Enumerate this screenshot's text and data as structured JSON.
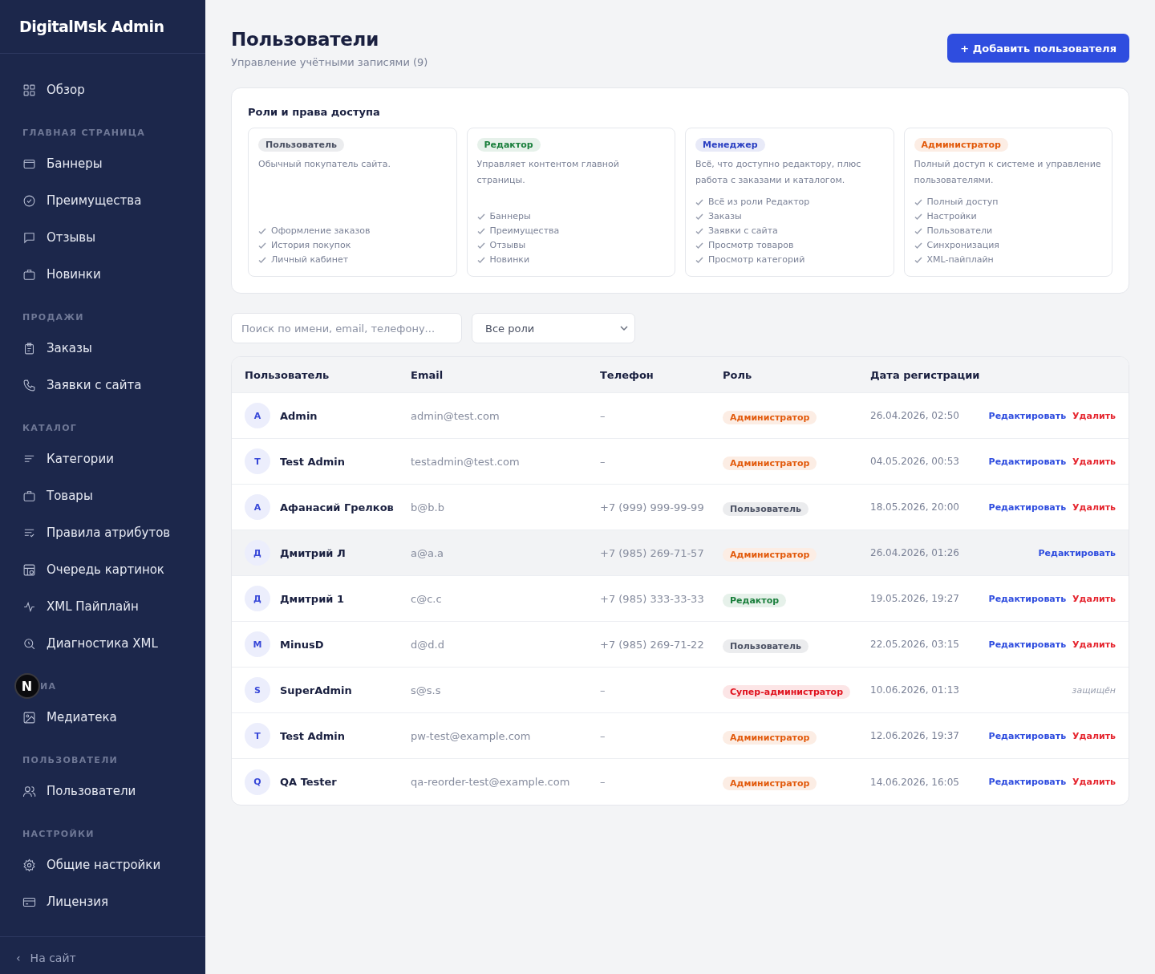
{
  "sidebar": {
    "logo": "DigitalMsk Admin",
    "sections": [
      {
        "items": [
          {
            "label": "Обзор"
          }
        ]
      },
      {
        "title": "ГЛАВНАЯ СТРАНИЦА",
        "items": [
          {
            "label": "Баннеры"
          },
          {
            "label": "Преимущества"
          },
          {
            "label": "Отзывы"
          },
          {
            "label": "Новинки"
          }
        ]
      },
      {
        "title": "ПРОДАЖИ",
        "items": [
          {
            "label": "Заказы"
          },
          {
            "label": "Заявки с сайта"
          }
        ]
      },
      {
        "title": "КАТАЛОГ",
        "items": [
          {
            "label": "Категории"
          },
          {
            "label": "Товары"
          },
          {
            "label": "Правила атрибутов"
          },
          {
            "label": "Очередь картинок"
          },
          {
            "label": "XML Пайплайн"
          },
          {
            "label": "Диагностика XML"
          }
        ]
      },
      {
        "title": "ИА",
        "badge": "N",
        "items": [
          {
            "label": "Медиатека"
          }
        ]
      },
      {
        "title": "ПОЛЬЗОВАТЕЛИ",
        "items": [
          {
            "label": "Пользователи"
          }
        ]
      },
      {
        "title": "НАСТРОЙКИ",
        "items": [
          {
            "label": "Общие настройки"
          },
          {
            "label": "Лицензия"
          }
        ]
      }
    ],
    "footer": {
      "icon": "‹",
      "label": "На сайт"
    }
  },
  "header": {
    "title": "Пользователи",
    "subtitle": "Управление учётными записями (9)",
    "add_button": "+ Добавить пользователя"
  },
  "roles": {
    "title": "Роли и права доступа",
    "cards": [
      {
        "color": "#4b5163",
        "badge": "Пользователь",
        "description": "Обычный покупатель сайта.",
        "permissions": [
          "Оформление заказов",
          "История покупок",
          "Личный кабинет"
        ]
      },
      {
        "color": "#1a7f3c",
        "badge": "Редактор",
        "description": "Управляет контентом главной страницы.",
        "permissions": [
          "Баннеры",
          "Преимущества",
          "Отзывы",
          "Новинки"
        ]
      },
      {
        "color": "#2a3fc2",
        "badge": "Менеджер",
        "description": "Всё, что доступно редактору, плюс работа с заказами и каталогом.",
        "permissions": [
          "Всё из роли Редактор",
          "Заказы",
          "Заявки с сайта",
          "Просмотр товаров",
          "Просмотр категорий"
        ]
      },
      {
        "color": "#e25a0c",
        "badge": "Администратор",
        "description": "Полный доступ к системе и управление пользователями.",
        "permissions": [
          "Полный доступ",
          "Настройки",
          "Пользователи",
          "Синхронизация",
          "XML-пайплайн"
        ]
      }
    ]
  },
  "filters": {
    "search": {
      "placeholder": "Поиск по имени, email, телефону..."
    },
    "role_select": {
      "value": "Все роли"
    }
  },
  "table": {
    "columns": [
      "Пользователь",
      "Email",
      "Телефон",
      "Роль",
      "Дата регистрации"
    ],
    "rows": [
      {
        "initial": "A",
        "name": "Admin",
        "email": "admin@test.com",
        "phone": "–",
        "role": {
          "label": "Администратор",
          "color": "#e25a0c"
        },
        "date": "26.04.2026, 02:50",
        "selected": false,
        "actions": [
          {
            "kind": "edit",
            "label": "Редактировать"
          },
          {
            "kind": "delete",
            "label": "Удалить"
          }
        ]
      },
      {
        "initial": "T",
        "name": "Test Admin",
        "email": "testadmin@test.com",
        "phone": "–",
        "role": {
          "label": "Администратор",
          "color": "#e25a0c"
        },
        "date": "04.05.2026, 00:53",
        "selected": false,
        "actions": [
          {
            "kind": "edit",
            "label": "Редактировать"
          },
          {
            "kind": "delete",
            "label": "Удалить"
          }
        ]
      },
      {
        "initial": "А",
        "name": "Афанасий Грелков",
        "email": "b@b.b",
        "phone": "+7 (999) 999-99-99",
        "role": {
          "label": "Пользователь",
          "color": "#4b5163"
        },
        "date": "18.05.2026, 20:00",
        "selected": false,
        "actions": [
          {
            "kind": "edit",
            "label": "Редактировать"
          },
          {
            "kind": "delete",
            "label": "Удалить"
          }
        ]
      },
      {
        "initial": "Д",
        "name": "Дмитрий Л",
        "email": "a@a.a",
        "phone": "+7 (985) 269-71-57",
        "role": {
          "label": "Администратор",
          "color": "#e25a0c"
        },
        "date": "26.04.2026, 01:26",
        "selected": true,
        "actions": [
          {
            "kind": "edit",
            "label": "Редактировать"
          }
        ]
      },
      {
        "initial": "Д",
        "name": "Дмитрий 1",
        "email": "c@c.c",
        "phone": "+7 (985) 333-33-33",
        "role": {
          "label": "Редактор",
          "color": "#1a7f3c"
        },
        "date": "19.05.2026, 19:27",
        "selected": false,
        "actions": [
          {
            "kind": "edit",
            "label": "Редактировать"
          },
          {
            "kind": "delete",
            "label": "Удалить"
          }
        ]
      },
      {
        "initial": "M",
        "name": "MinusD",
        "email": "d@d.d",
        "phone": "+7 (985) 269-71-22",
        "role": {
          "label": "Пользователь",
          "color": "#4b5163"
        },
        "date": "22.05.2026, 03:15",
        "selected": false,
        "actions": [
          {
            "kind": "edit",
            "label": "Редактировать"
          },
          {
            "kind": "delete",
            "label": "Удалить"
          }
        ]
      },
      {
        "initial": "S",
        "name": "SuperAdmin",
        "email": "s@s.s",
        "phone": "–",
        "role": {
          "label": "Супер-администратор",
          "color": "#e0121e"
        },
        "date": "10.06.2026, 01:13",
        "selected": false,
        "actions": [
          {
            "kind": "protected",
            "label": "защищён"
          }
        ]
      },
      {
        "initial": "T",
        "name": "Test Admin",
        "email": "pw-test@example.com",
        "phone": "–",
        "role": {
          "label": "Администратор",
          "color": "#e25a0c"
        },
        "date": "12.06.2026, 19:37",
        "selected": false,
        "actions": [
          {
            "kind": "edit",
            "label": "Редактировать"
          },
          {
            "kind": "delete",
            "label": "Удалить"
          }
        ]
      },
      {
        "initial": "Q",
        "name": "QA Tester",
        "email": "qa-reorder-test@example.com",
        "phone": "–",
        "role": {
          "label": "Администратор",
          "color": "#e25a0c"
        },
        "date": "14.06.2026, 16:05",
        "selected": false,
        "actions": [
          {
            "kind": "edit",
            "label": "Редактировать"
          },
          {
            "kind": "delete",
            "label": "Удалить"
          }
        ]
      }
    ]
  }
}
